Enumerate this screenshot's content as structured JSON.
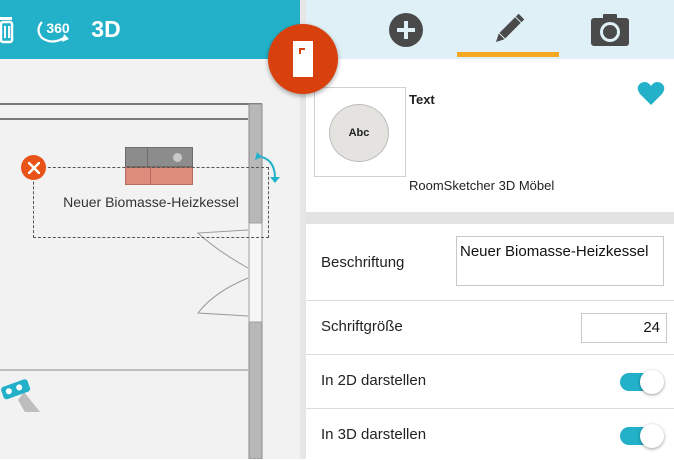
{
  "toolbar_left": {
    "icons": [
      "trash-icon",
      "rotate-360-icon"
    ],
    "view_360_label": "360",
    "view_3d_label": "3D"
  },
  "toolbar_right": {
    "tabs": [
      "add-icon",
      "pencil-icon",
      "camera-icon"
    ],
    "active_tab": "pencil-icon"
  },
  "canvas": {
    "object_label": "Neuer Biomasse-Heizkessel"
  },
  "item": {
    "title": "Text",
    "thumbnail_text": "Abc",
    "source": "RoomSketcher 3D Möbel",
    "favorite": true
  },
  "properties": {
    "caption_label": "Beschriftung",
    "caption_value": "Neuer Biomasse-Heizkessel",
    "font_size_label": "Schriftgröße",
    "font_size_value": "24",
    "show_2d_label": "In 2D darstellen",
    "show_2d": true,
    "show_3d_label": "In 3D darstellen",
    "show_3d": true
  },
  "colors": {
    "accent": "#22b1c9",
    "fab": "#d8400e",
    "active_tab_underline": "#f7a823",
    "selection_delete": "#e8531a"
  }
}
